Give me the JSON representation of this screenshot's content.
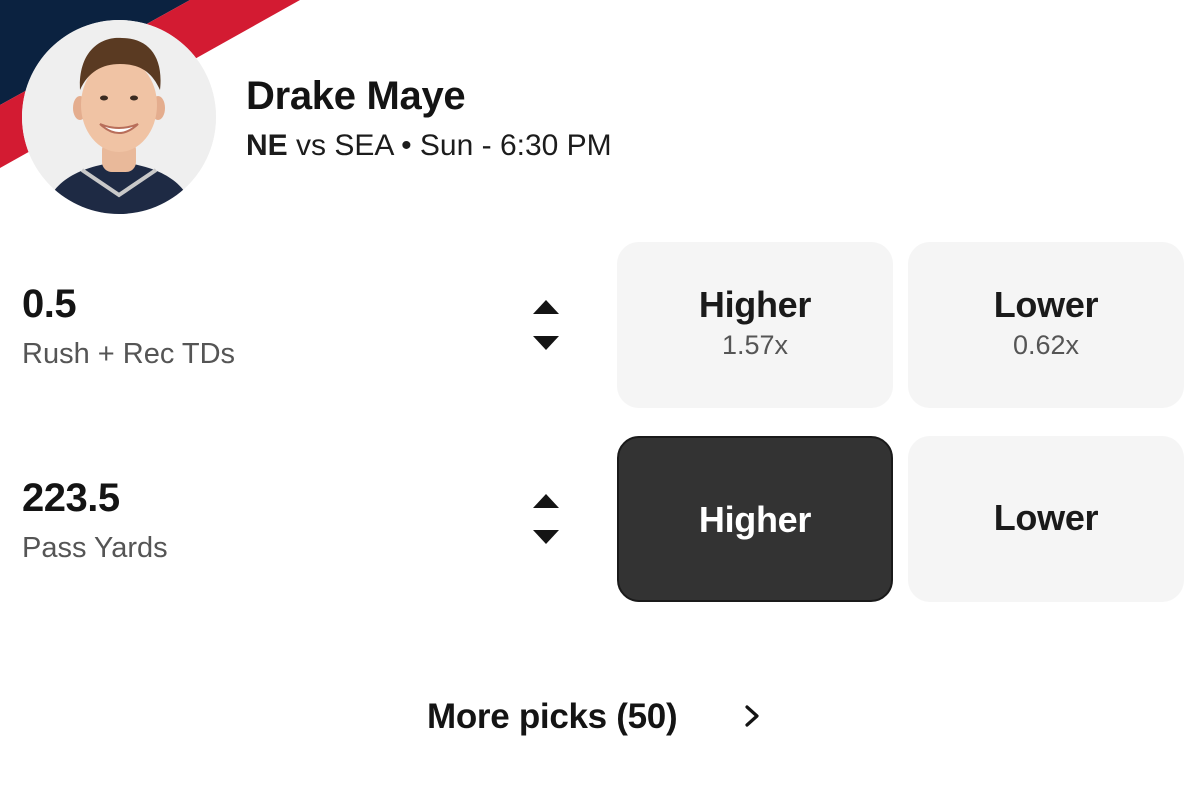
{
  "player": {
    "name": "Drake Maye",
    "team": "NE",
    "matchup_rest": " vs SEA • Sun - 6:30 PM",
    "team_colors": {
      "navy": "#0b2240",
      "red": "#d31b32"
    }
  },
  "props": [
    {
      "line": "0.5",
      "stat": "Rush + Rec TDs",
      "higher_label": "Higher",
      "higher_multiplier": "1.57x",
      "lower_label": "Lower",
      "lower_multiplier": "0.62x",
      "selected": "none"
    },
    {
      "line": "223.5",
      "stat": "Pass Yards",
      "higher_label": "Higher",
      "lower_label": "Lower",
      "selected": "higher"
    }
  ],
  "more_picks": {
    "label": "More picks (50)",
    "icon": "chevron-right-icon"
  },
  "icons": {
    "toggle": "up-down-arrows-icon"
  },
  "colors": {
    "selected_button": "#333333",
    "unselected_button": "#f5f5f5",
    "text_primary": "#141414",
    "text_secondary": "#555555"
  }
}
